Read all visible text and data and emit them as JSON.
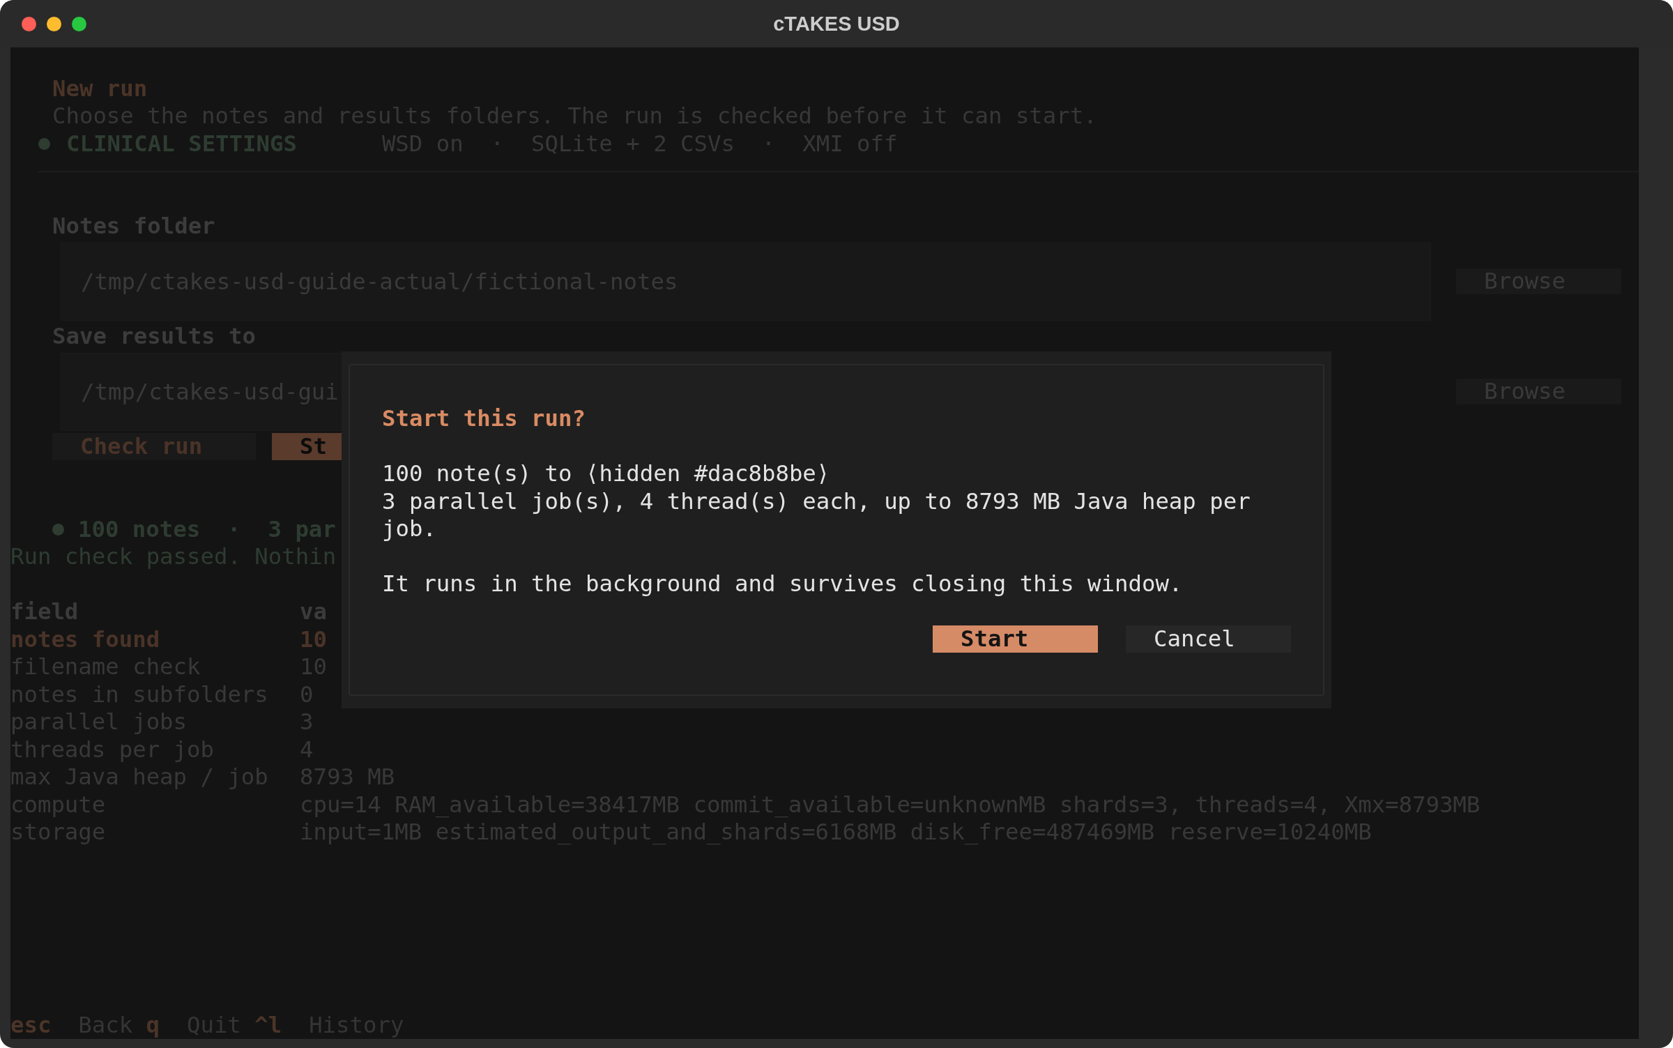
{
  "window": {
    "title": "cTAKES USD"
  },
  "header": {
    "title": "New run",
    "subtitle": "Choose the notes and results folders. The run is checked before it can start.",
    "profile": {
      "label": "CLINICAL SETTINGS",
      "active": true
    },
    "summary": "WSD on  ·  SQLite + 2 CSVs  ·  XMI off"
  },
  "folders": [
    {
      "label": "Notes folder",
      "value": "/tmp/ctakes-usd-guide-actual/fictional-notes",
      "button": "Browse"
    },
    {
      "label": "Save results to",
      "value": "/tmp/ctakes-usd-gui",
      "button": "Browse"
    }
  ],
  "actions": [
    {
      "label": "Check run",
      "kind": "secondary"
    },
    {
      "label": "St",
      "kind": "primary"
    }
  ],
  "check": {
    "passed": true,
    "summary": "100 notes  ·  3 par",
    "message": "Run check passed. Nothin"
  },
  "table": {
    "columns": [
      "field",
      "va"
    ],
    "rows": [
      {
        "field": "notes found",
        "value": "10",
        "selected": true
      },
      {
        "field": "filename check",
        "value": "10",
        "selected": false
      },
      {
        "field": "notes in subfolders",
        "value": "0",
        "selected": false
      },
      {
        "field": "parallel jobs",
        "value": "3",
        "selected": false
      },
      {
        "field": "threads per job",
        "value": "4",
        "selected": false
      },
      {
        "field": "max Java heap / job",
        "value": "8793 MB",
        "selected": false
      },
      {
        "field": "compute",
        "value": "cpu=14 RAM_available=38417MB commit_available=unknownMB shards=3, threads=4, Xmx=8793MB",
        "selected": false
      },
      {
        "field": "storage",
        "value": "input=1MB estimated_output_and_shards=6168MB disk_free=487469MB reserve=10240MB",
        "selected": false
      }
    ]
  },
  "dialog": {
    "title": "Start this run?",
    "paragraphs": [
      {
        "lines": [
          "100 note(s) to ⟨hidden #dac8b8be⟩",
          "3 parallel job(s), 4 thread(s) each, up to 8793 MB Java heap per job."
        ]
      },
      {
        "lines": [
          "It runs in the background and survives closing this window."
        ]
      }
    ],
    "buttons": [
      {
        "label": "Start",
        "kind": "primary"
      },
      {
        "label": "Cancel",
        "kind": "secondary"
      }
    ]
  },
  "footer": [
    {
      "key": "esc",
      "label": "Back"
    },
    {
      "key": "q",
      "label": "Quit"
    },
    {
      "key": "^l",
      "label": "History"
    }
  ]
}
